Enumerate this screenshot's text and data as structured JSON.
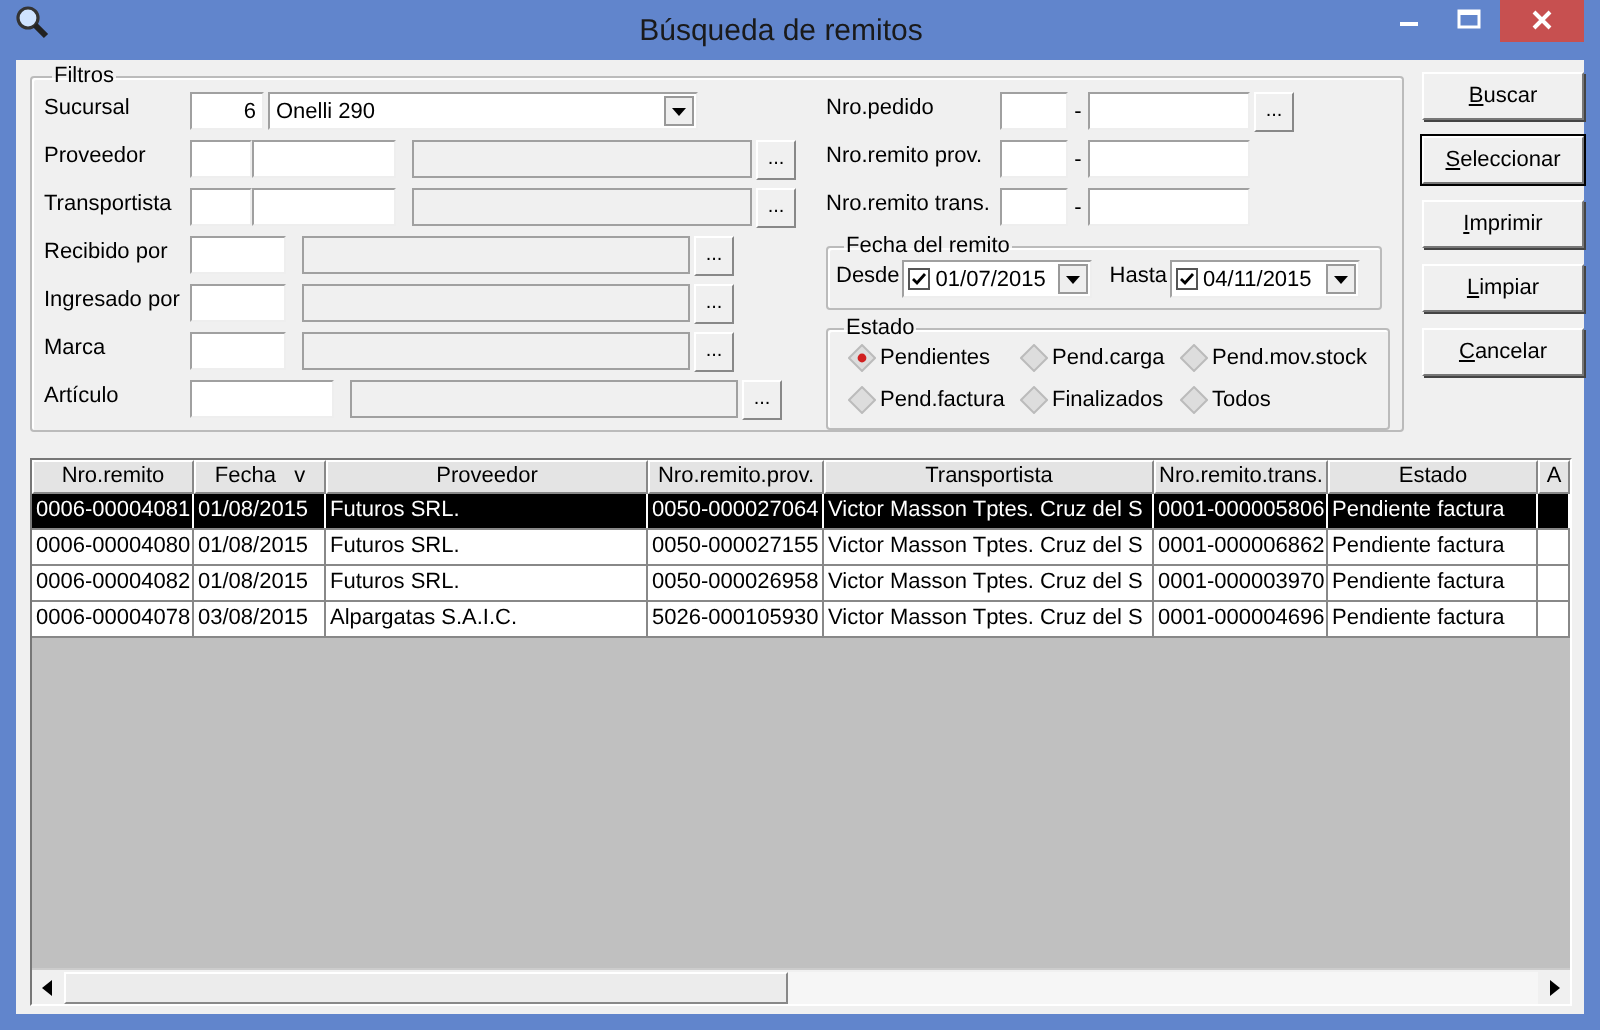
{
  "window": {
    "title": "Búsqueda de remitos"
  },
  "filters": {
    "title": "Filtros",
    "left_rows": [
      {
        "kind": "combo",
        "label": "Sucursal",
        "code": "6",
        "value": "Onelli 290"
      },
      {
        "kind": "pair_lookup",
        "label": "Proveedor",
        "button": "..."
      },
      {
        "kind": "pair_lookup",
        "label": "Transportista",
        "button": "..."
      },
      {
        "kind": "lookup",
        "label": "Recibido por",
        "button": "..."
      },
      {
        "kind": "lookup",
        "label": "Ingresado por",
        "button": "..."
      },
      {
        "kind": "lookup",
        "label": "Marca",
        "button": "..."
      },
      {
        "kind": "lookup_long",
        "label": "Artículo",
        "button": "..."
      }
    ],
    "right_rows": [
      {
        "kind": "range_lookup",
        "label": "Nro.pedido",
        "separator": "-",
        "button": "..."
      },
      {
        "kind": "range",
        "label": "Nro.remito prov.",
        "separator": "-"
      },
      {
        "kind": "range",
        "label": "Nro.remito trans.",
        "separator": "-"
      }
    ],
    "date_group": {
      "title": "Fecha del remito",
      "from": {
        "label": "Desde",
        "checked": true,
        "value": "01/07/2015"
      },
      "to": {
        "label": "Hasta",
        "checked": true,
        "value": "04/11/2015"
      }
    },
    "status_group": {
      "title": "Estado",
      "options": [
        {
          "label": "Pendientes",
          "selected": true
        },
        {
          "label": "Pend.carga",
          "selected": false
        },
        {
          "label": "Pend.mov.stock",
          "selected": false
        },
        {
          "label": "Pend.factura",
          "selected": false
        },
        {
          "label": "Finalizados",
          "selected": false
        },
        {
          "label": "Todos",
          "selected": false
        }
      ]
    }
  },
  "buttons": [
    {
      "label": "Buscar",
      "default": false
    },
    {
      "label": "Seleccionar",
      "default": true
    },
    {
      "label": "Imprimir",
      "default": false
    },
    {
      "label": "Limpiar",
      "default": false
    },
    {
      "label": "Cancelar",
      "default": false
    }
  ],
  "table": {
    "columns": [
      {
        "label": "Nro.remito"
      },
      {
        "label": "Fecha",
        "sort_mark": "v"
      },
      {
        "label": "Proveedor"
      },
      {
        "label": "Nro.remito.prov."
      },
      {
        "label": "Transportista"
      },
      {
        "label": "Nro.remito.trans."
      },
      {
        "label": "Estado"
      },
      {
        "label": "A"
      }
    ],
    "rows": [
      {
        "selected": true,
        "cells": [
          "0006-00004081",
          "01/08/2015",
          "Futuros SRL.",
          "0050-000027064",
          "Victor Masson Tptes. Cruz del S",
          "0001-000005806",
          "Pendiente factura",
          ""
        ]
      },
      {
        "selected": false,
        "cells": [
          "0006-00004080",
          "01/08/2015",
          "Futuros SRL.",
          "0050-000027155",
          "Victor Masson Tptes. Cruz del S",
          "0001-000006862",
          "Pendiente factura",
          ""
        ]
      },
      {
        "selected": false,
        "cells": [
          "0006-00004082",
          "01/08/2015",
          "Futuros SRL.",
          "0050-000026958",
          "Victor Masson Tptes. Cruz del S",
          "0001-000003970",
          "Pendiente factura",
          ""
        ]
      },
      {
        "selected": false,
        "cells": [
          "0006-00004078",
          "03/08/2015",
          "Alpargatas S.A.I.C.",
          "5026-000105930",
          "Victor Masson Tptes. Cruz del S",
          "0001-000004696",
          "Pendiente factura",
          ""
        ]
      }
    ]
  }
}
